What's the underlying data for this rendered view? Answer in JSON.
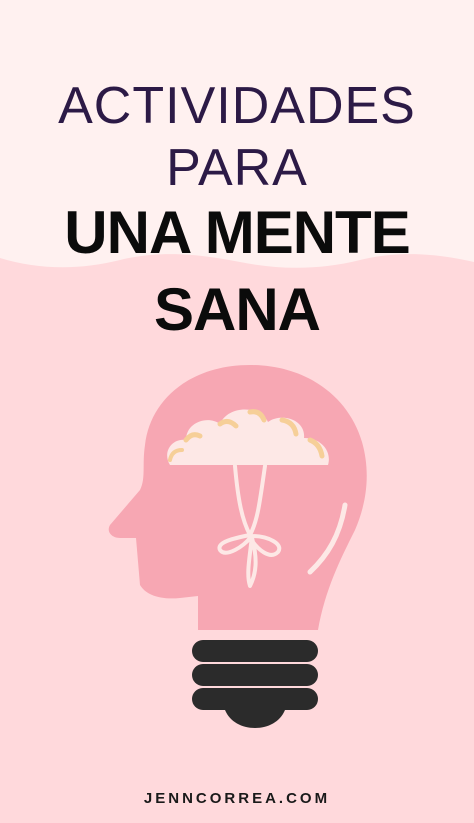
{
  "title": {
    "line1": "ACTIVIDADES",
    "line2": "PARA"
  },
  "headline": {
    "line1": "UNA MENTE",
    "line2": "SANA"
  },
  "footer": {
    "website": "JENNCORREA.COM"
  },
  "illustration": {
    "icon": "lightbulb-head-brain-icon"
  },
  "colors": {
    "background_top": "#fff1f0",
    "background_main": "#ffd9dc",
    "title_purple": "#2c1a46",
    "headline_black": "#0b0b0b",
    "head_pink": "#f7a7b3",
    "brain_cream": "#fde8e6",
    "brain_yellow": "#f6cf98",
    "bulb_base": "#2b2b2b"
  }
}
